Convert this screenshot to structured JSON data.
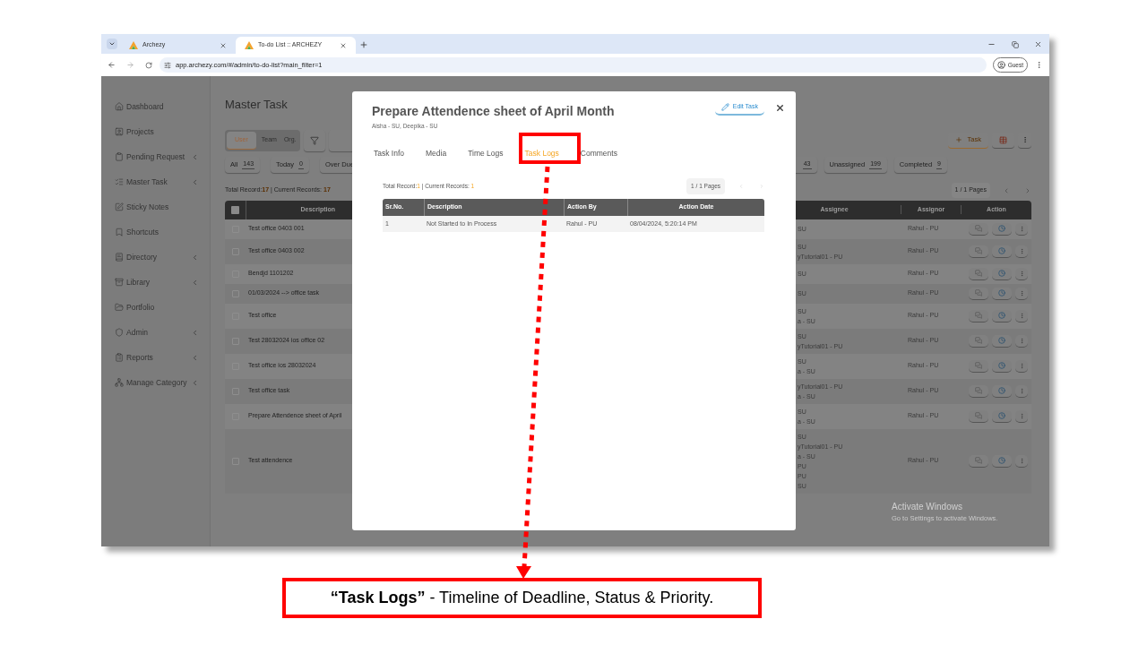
{
  "browser": {
    "tabs": [
      {
        "title": "Archezy",
        "selected": false
      },
      {
        "title": "To-do List :: ARCHEZY",
        "selected": true
      }
    ],
    "url": "app.archezy.com/#/admin/to-do-list?main_filter=1",
    "profile": "Guest"
  },
  "sidebar": {
    "items": [
      {
        "label": "Dashboard",
        "has_submenu": false
      },
      {
        "label": "Projects",
        "has_submenu": false
      },
      {
        "label": "Pending Request",
        "has_submenu": true
      },
      {
        "label": "Master Task",
        "has_submenu": true
      },
      {
        "label": "Sticky Notes",
        "has_submenu": false
      },
      {
        "label": "Shortcuts",
        "has_submenu": false
      },
      {
        "label": "Directory",
        "has_submenu": true
      },
      {
        "label": "Library",
        "has_submenu": true
      },
      {
        "label": "Portfolio",
        "has_submenu": false
      },
      {
        "label": "Admin",
        "has_submenu": true
      },
      {
        "label": "Reports",
        "has_submenu": true
      },
      {
        "label": "Manage Category",
        "has_submenu": true
      }
    ]
  },
  "page": {
    "title": "Master Task",
    "scope_toggle": [
      {
        "label": "User",
        "selected": true
      },
      {
        "label": "Team",
        "selected": false
      },
      {
        "label": "Org.",
        "selected": false
      }
    ],
    "add_button": "Task",
    "filters_left": [
      {
        "label": "All",
        "count": "143"
      },
      {
        "label": "Today",
        "count": "0"
      },
      {
        "label": "Over Due"
      }
    ],
    "filters_right": [
      {
        "count": "43"
      },
      {
        "label": "Unassigned",
        "count": "199"
      },
      {
        "label": "Completed",
        "count": "9"
      }
    ],
    "total_label": "Total Record:",
    "total": "17",
    "current_label": "| Current Records:",
    "current": "17",
    "pages": "1 / 1 Pages",
    "table": {
      "select_all_checked": false,
      "columns": [
        "Description",
        "Assignee",
        "Assignor",
        "Action"
      ],
      "rows": [
        {
          "checked": false,
          "description": "Test office 0403 001",
          "assignee": [
            "SU"
          ],
          "assignor": "Rahul - PU"
        },
        {
          "checked": false,
          "description": "Test office 0403 002",
          "assignee": [
            "SU",
            "yTutorial01 - PU"
          ],
          "assignor": "Rahul - PU"
        },
        {
          "checked": false,
          "description": "Bendjd 1101202",
          "assignee": [
            "SU"
          ],
          "assignor": "Rahul - PU"
        },
        {
          "checked": false,
          "description": "01/03/2024 --> office task",
          "assignee": [
            "SU"
          ],
          "assignor": "Rahul - PU"
        },
        {
          "checked": false,
          "description": "Test office",
          "assignee": [
            "SU",
            "a - SU"
          ],
          "assignor": "Rahul - PU"
        },
        {
          "checked": false,
          "description": "Test 28032024 ios office 02",
          "assignee": [
            "SU",
            "yTutorial01 - PU"
          ],
          "assignor": "Rahul - PU"
        },
        {
          "checked": false,
          "description": "Test office ios 28032024",
          "assignee": [
            "SU",
            "a - SU"
          ],
          "assignor": "Rahul - PU"
        },
        {
          "checked": false,
          "description": "Test office task",
          "assignee": [
            "yTutorial01 - PU",
            "a - SU"
          ],
          "assignor": "Rahul - PU"
        },
        {
          "checked": false,
          "description": "Prepare Attendence sheet of April",
          "assignee": [
            "SU",
            "a - SU"
          ],
          "assignor": "Rahul - PU"
        },
        {
          "checked": false,
          "description": "Test attendence",
          "assignee": [
            "SU",
            "yTutorial01 - PU",
            "a - SU",
            "PU",
            "PU",
            "SU"
          ],
          "assignor": "Rahul - PU"
        }
      ]
    }
  },
  "modal": {
    "title": "Prepare Attendence sheet of April Month",
    "subtitle": "Aisha - SU, Deepika - SU",
    "edit_button": "Edit Task",
    "tabs": [
      {
        "label": "Task Info",
        "selected": false
      },
      {
        "label": "Media",
        "selected": false
      },
      {
        "label": "Time Logs",
        "selected": false
      },
      {
        "label": "Task Logs",
        "selected": true
      },
      {
        "label": "Comments",
        "selected": false
      }
    ],
    "total_label": "Total Record:",
    "total": "1",
    "current_label": "| Current Records:",
    "current": "1",
    "pages": "1 / 1 Pages",
    "table": {
      "columns": [
        "Sr.No.",
        "Description",
        "Action By",
        "Action Date"
      ],
      "rows": [
        [
          "1",
          "Not Started to In Process",
          "Rahul - PU",
          "08/04/2024, 5:20:14 PM"
        ]
      ]
    }
  },
  "watermark": {
    "title": "Activate Windows",
    "subtitle": "Go to Settings to activate Windows."
  },
  "caption": "**“Task Logs”** - Timeline of Deadline, Status & Priority."
}
